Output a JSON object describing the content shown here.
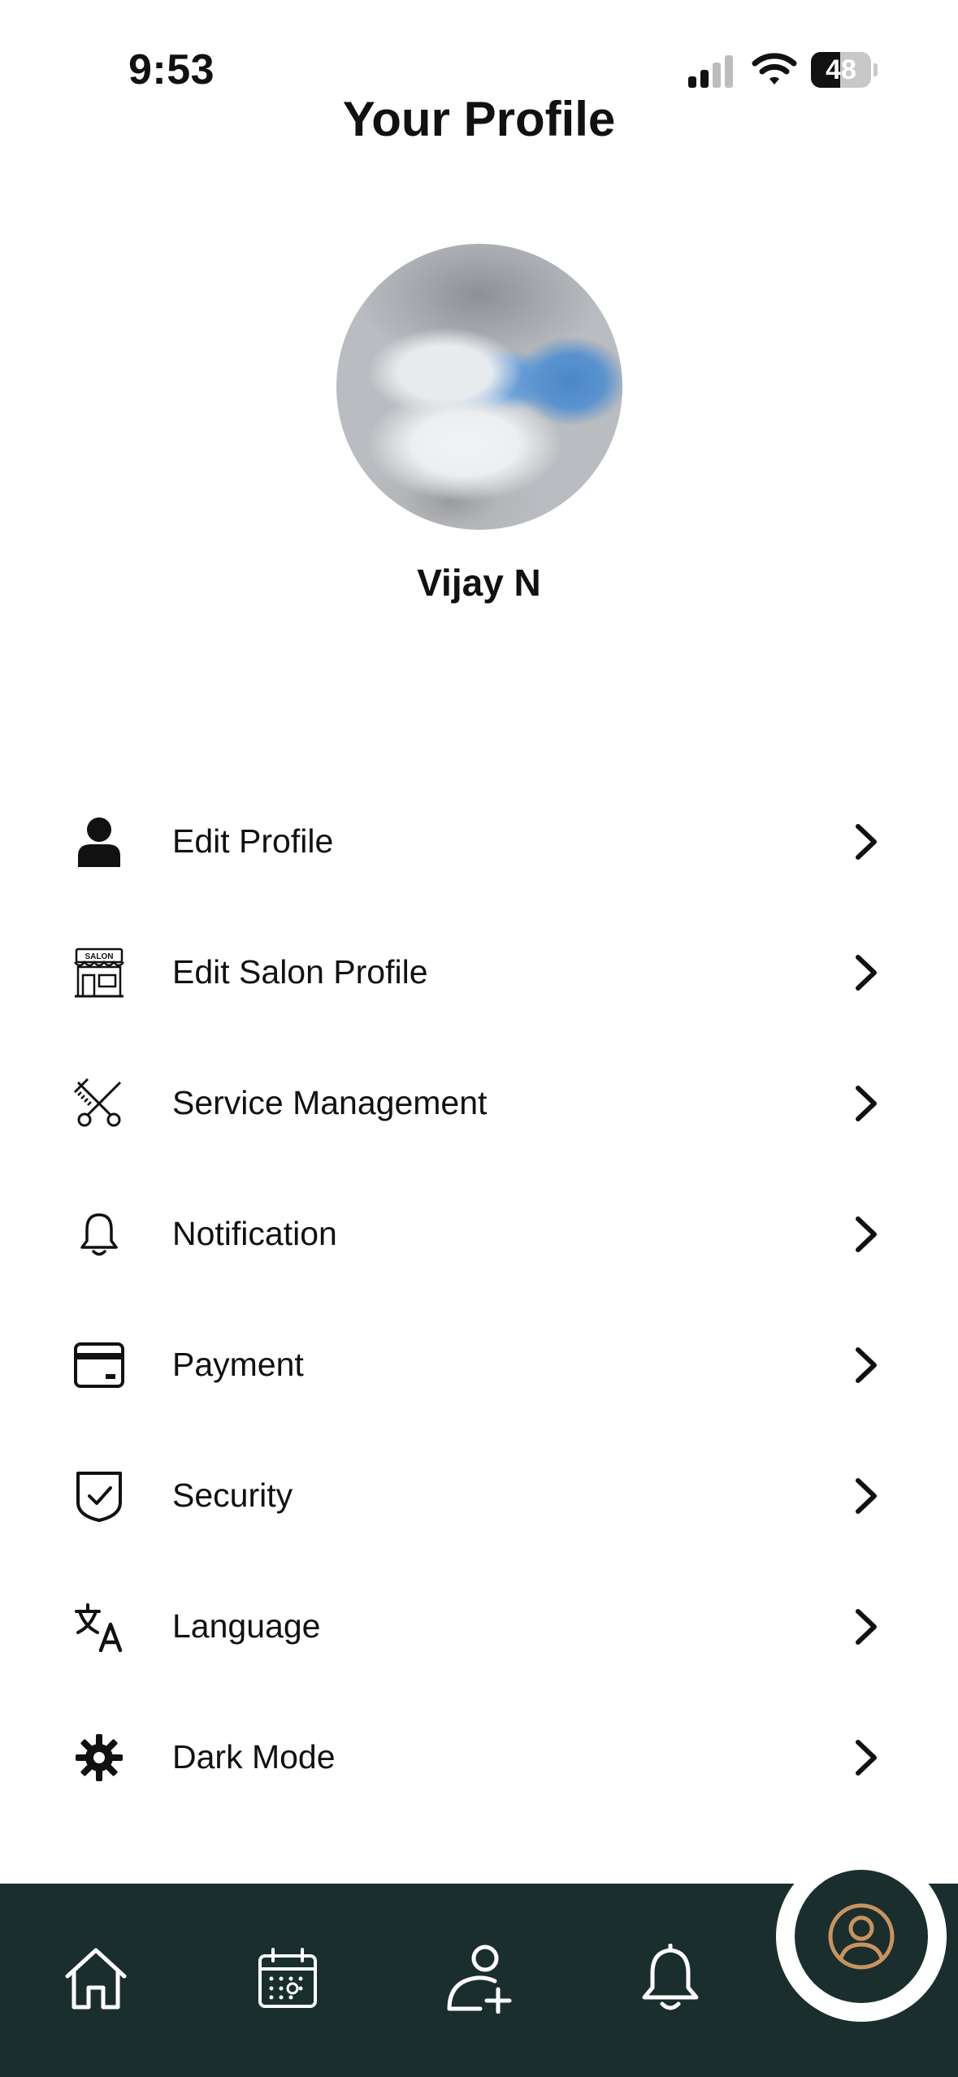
{
  "status_bar": {
    "time": "9:53",
    "battery": "48",
    "battery_level": 0.48
  },
  "header": {
    "title": "Your Profile"
  },
  "profile": {
    "name": "Vijay N"
  },
  "menu": {
    "items": [
      {
        "label": "Edit Profile",
        "icon": "person-icon"
      },
      {
        "label": "Edit Salon Profile",
        "icon": "salon-storefront-icon"
      },
      {
        "label": "Service Management",
        "icon": "scissors-comb-icon"
      },
      {
        "label": "Notification",
        "icon": "bell-icon"
      },
      {
        "label": "Payment",
        "icon": "credit-card-icon"
      },
      {
        "label": "Security",
        "icon": "shield-check-icon"
      },
      {
        "label": "Language",
        "icon": "translate-icon"
      },
      {
        "label": "Dark Mode",
        "icon": "sun-gear-icon"
      }
    ]
  },
  "bottom_nav": {
    "items": [
      {
        "icon": "home-icon"
      },
      {
        "icon": "calendar-icon"
      },
      {
        "icon": "add-user-icon"
      },
      {
        "icon": "bell-icon"
      },
      {
        "icon": "profile-icon",
        "active": true
      }
    ]
  },
  "colors": {
    "nav_background": "#1b2e2e",
    "accent": "#c9935f",
    "text": "#111111"
  },
  "avatar_icon_text": "SALON"
}
